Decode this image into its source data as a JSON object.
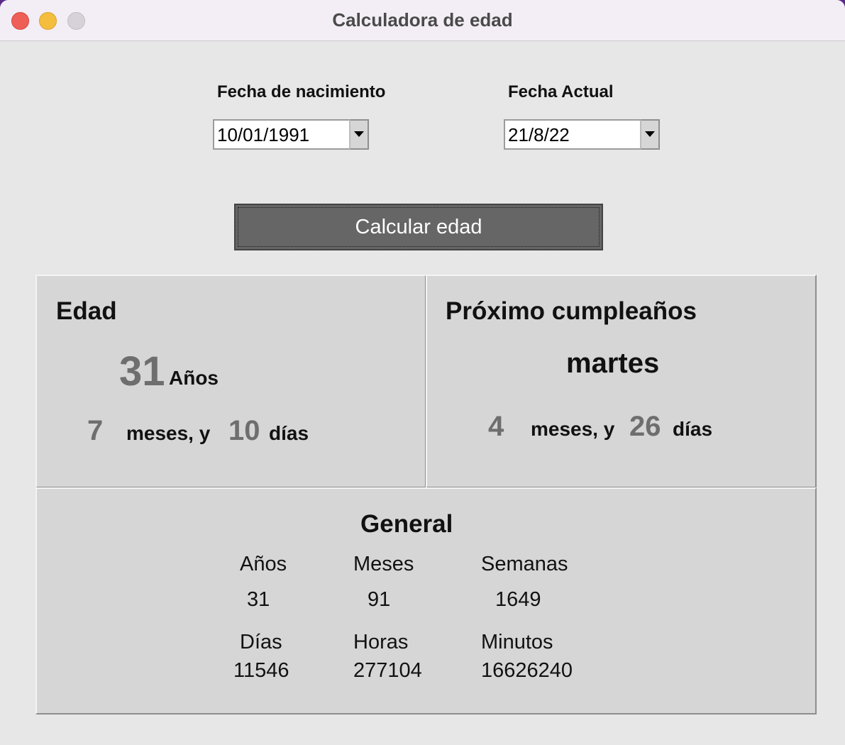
{
  "window": {
    "title": "Calculadora de edad"
  },
  "inputs": {
    "birth": {
      "label": "Fecha de nacimiento",
      "value": "10/01/1991"
    },
    "current": {
      "label": "Fecha Actual",
      "value": "21/8/22"
    }
  },
  "button": {
    "label": "Calcular edad"
  },
  "edad": {
    "title": "Edad",
    "years": "31",
    "years_label": "Años",
    "months": "7",
    "months_label": "meses, y",
    "days": "10",
    "days_label": "días"
  },
  "proximo": {
    "title": "Próximo cumpleaños",
    "weekday": "martes",
    "months": "4",
    "months_label": "meses, y",
    "days": "26",
    "days_label": "días"
  },
  "general": {
    "title": "General",
    "items": [
      {
        "label": "Años",
        "value": "31"
      },
      {
        "label": "Meses",
        "value": "91"
      },
      {
        "label": "Semanas",
        "value": "1649"
      },
      {
        "label": "Días",
        "value": "11546"
      },
      {
        "label": "Horas",
        "value": "277104"
      },
      {
        "label": "Minutos",
        "value": "16626240"
      }
    ]
  }
}
